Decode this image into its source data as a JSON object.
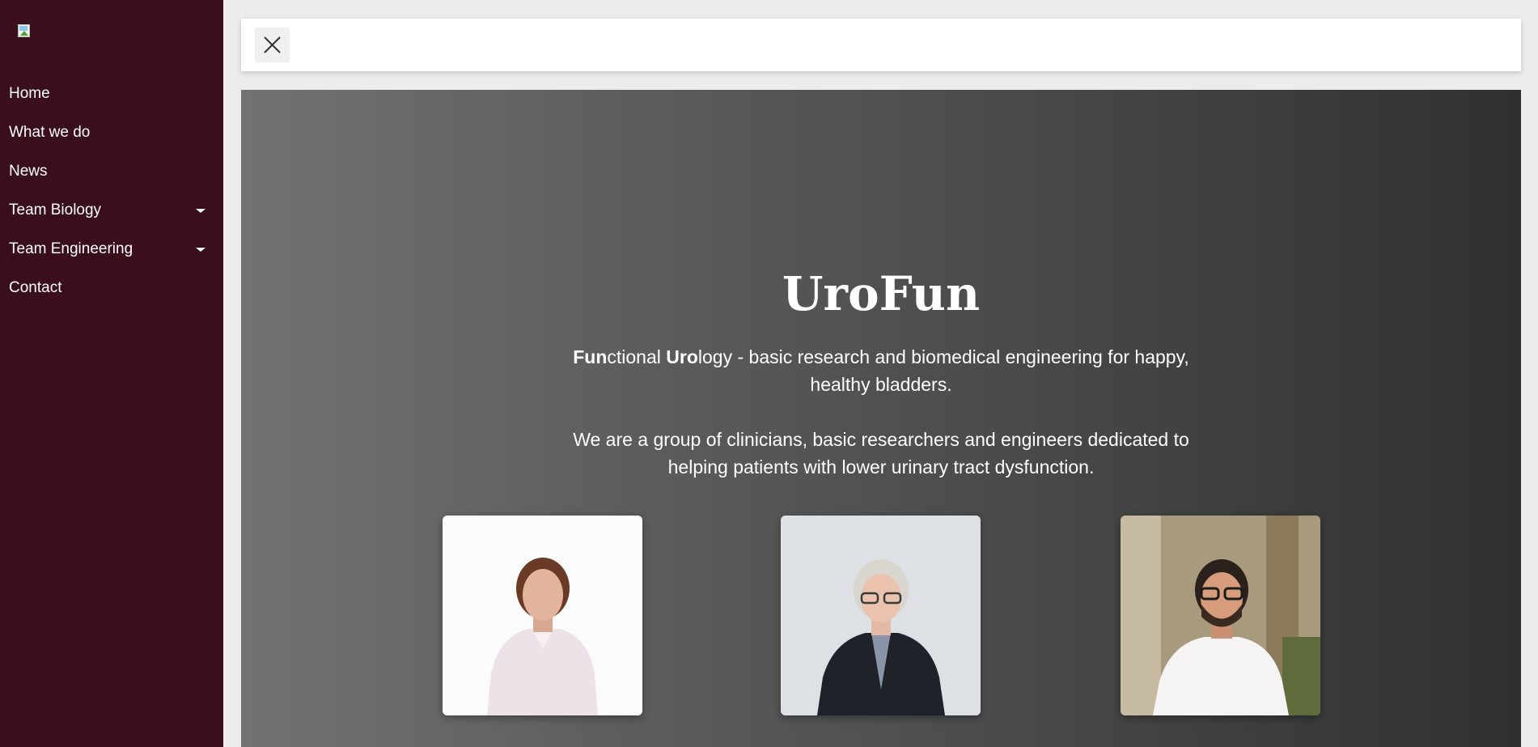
{
  "sidebar": {
    "logo_alt": "",
    "items": [
      {
        "label": "Home",
        "has_dropdown": false
      },
      {
        "label": "What we do",
        "has_dropdown": false
      },
      {
        "label": "News",
        "has_dropdown": false
      },
      {
        "label": "Team Biology",
        "has_dropdown": true
      },
      {
        "label": "Team Engineering",
        "has_dropdown": true
      },
      {
        "label": "Contact",
        "has_dropdown": false
      }
    ]
  },
  "topbar": {
    "close_icon": "close-icon"
  },
  "hero": {
    "title": "UroFun",
    "tagline": {
      "bold1": "Fun",
      "text1": "ctional ",
      "bold2": "Uro",
      "text2": "logy - basic research and biomedical engineering for happy, healthy bladders."
    },
    "description": "We are a group of clinicians, basic researchers and engineers dedicated to helping patients with lower urinary tract dysfunction."
  },
  "team_photos": [
    {
      "icon": "person-photo-1"
    },
    {
      "icon": "person-photo-2"
    },
    {
      "icon": "person-photo-3"
    }
  ],
  "colors": {
    "sidebar_bg": "#3b0e1c",
    "hero_gradient_start": "#727272",
    "hero_gradient_end": "#303030"
  }
}
